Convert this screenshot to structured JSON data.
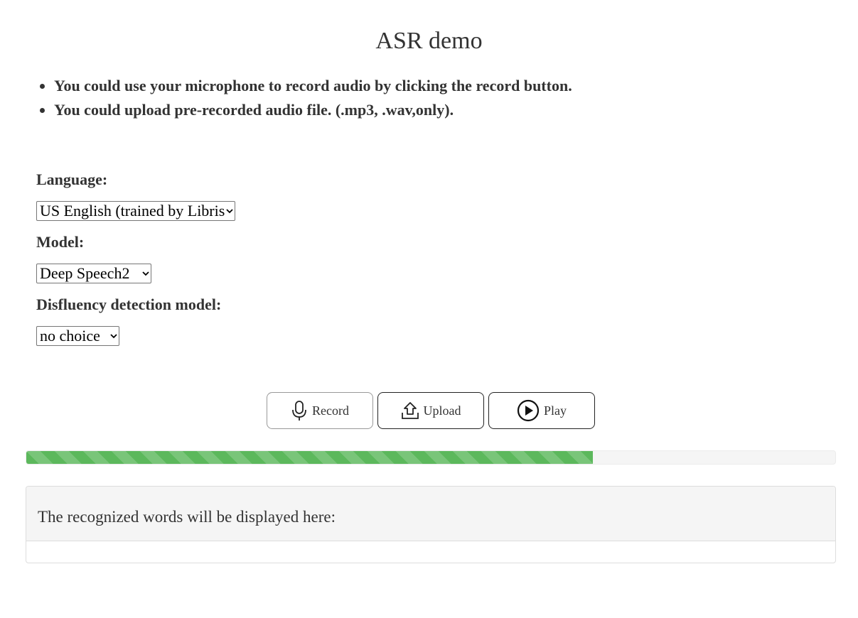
{
  "page": {
    "title": "ASR demo"
  },
  "instructions": [
    "You could use your microphone to record audio by clicking the record button.",
    "You could upload pre-recorded audio file. (.mp3, .wav,only)."
  ],
  "form": {
    "language": {
      "label": "Language:",
      "selected": "US English (trained by Librispeech)"
    },
    "model": {
      "label": "Model:",
      "selected": "Deep Speech2"
    },
    "disfluency": {
      "label": "Disfluency detection model:",
      "selected": "no choice"
    }
  },
  "controls": {
    "record": {
      "label": "Record",
      "icon": "microphone-icon"
    },
    "upload": {
      "label": "Upload",
      "icon": "upload-icon"
    },
    "play": {
      "label": "Play",
      "icon": "play-icon"
    }
  },
  "progress": {
    "percent": 70,
    "color": "#5cb85c"
  },
  "result": {
    "heading": "The recognized words will be displayed here:",
    "text": ""
  }
}
